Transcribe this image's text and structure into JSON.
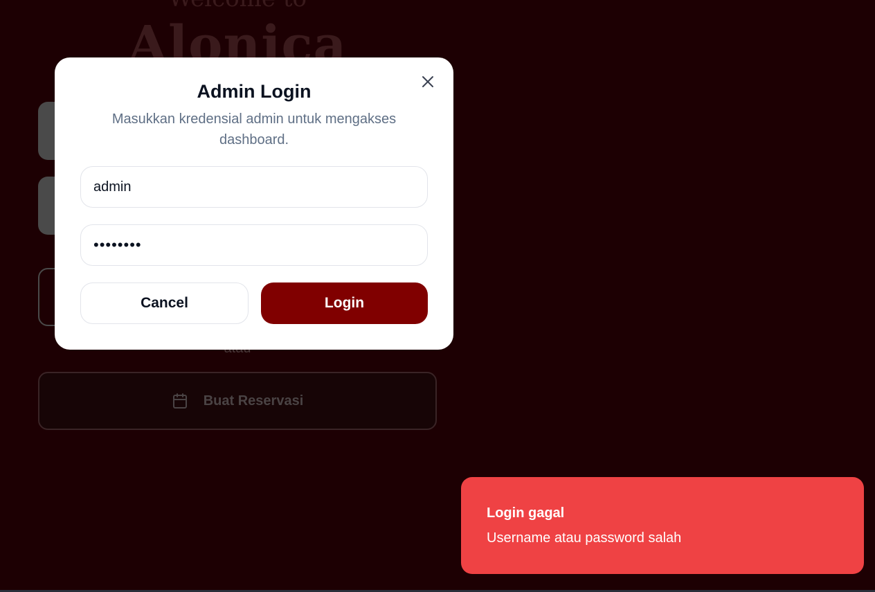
{
  "background": {
    "welcome_text": "Welcome to",
    "brand_name": "Alonica",
    "separator_text": "atau",
    "reserve_button_label": "Buat Reservasi"
  },
  "modal": {
    "title": "Admin Login",
    "subtitle": "Masukkan kredensial admin untuk mengakses dashboard.",
    "username_value": "admin",
    "password_value": "••••••••",
    "cancel_label": "Cancel",
    "login_label": "Login"
  },
  "toast": {
    "title": "Login gagal",
    "message": "Username atau password salah"
  },
  "colors": {
    "page_background": "#1d0003",
    "login_button": "#800000",
    "toast_background": "#ef4244"
  },
  "icons": {
    "close": "close-icon",
    "reserve": "calendar-icon"
  }
}
